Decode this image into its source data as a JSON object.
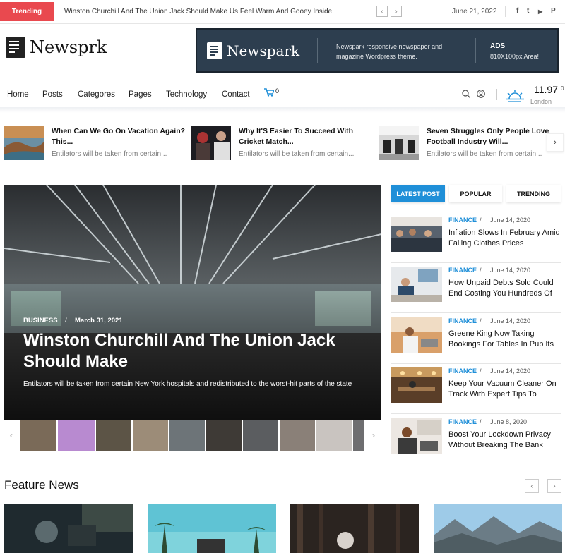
{
  "topbar": {
    "trending_label": "Trending",
    "trending_text": "Winston Churchill And The Union Jack Should Make Us Feel Warm And Gooey Inside",
    "prev_label": "‹",
    "next_label": "›",
    "date": "June 21, 2022",
    "social": [
      "f",
      "t",
      "▶",
      "P"
    ]
  },
  "logo": {
    "text": "Newsprk"
  },
  "ad": {
    "logo_text": "Newspark",
    "description": "Newspark responsive newspaper and magazine Wordpress theme.",
    "label": "ADS",
    "size": "810X100px Area!"
  },
  "nav": {
    "items": [
      "Home",
      "Posts",
      "Categores",
      "Pages",
      "Technology",
      "Contact"
    ],
    "cart_count": "0",
    "weather": {
      "temp": "11.97",
      "deg": "0",
      "city": "London"
    }
  },
  "strip": {
    "items": [
      {
        "title": "When Can We Go On Vacation Again? This...",
        "sub": "Entilators will be taken from certain..."
      },
      {
        "title": "Why It'S Easier To Succeed With Cricket Match...",
        "sub": "Entilators will be taken from certain..."
      },
      {
        "title": "Seven Struggles Only People Love Football Industry Will...",
        "sub": "Entilators will be taken from certain..."
      }
    ],
    "next_label": "›"
  },
  "hero": {
    "category": "BUSINESS",
    "slash": "/",
    "date": "March 31, 2021",
    "title": "Winston Churchill And The Union Jack Should Make",
    "description": "Entilators will be taken from certain New York hospitals and redistributed to the worst-hit parts of the state",
    "prev_label": "‹",
    "next_label": "›"
  },
  "sidebar": {
    "tabs": [
      "LATEST POST",
      "POPULAR",
      "TRENDING"
    ],
    "posts": [
      {
        "category": "FINANCE",
        "date": "June 14, 2020",
        "title": "Inflation Slows In February Amid Falling Clothes Prices"
      },
      {
        "category": "FINANCE",
        "date": "June 14, 2020",
        "title": "How Unpaid Debts Sold Could End Costing You Hundreds Of"
      },
      {
        "category": "FINANCE",
        "date": "June 14, 2020",
        "title": "Greene King Now Taking Bookings For Tables In Pub Its"
      },
      {
        "category": "FINANCE",
        "date": "June 14, 2020",
        "title": "Keep Your Vacuum Cleaner On Track With Expert Tips To"
      },
      {
        "category": "FINANCE",
        "date": "June 8, 2020",
        "title": "Boost Your Lockdown Privacy Without Breaking The Bank"
      }
    ]
  },
  "feature": {
    "title": "Feature News",
    "prev_label": "‹",
    "next_label": "›"
  },
  "colors": {
    "accent": "#1f8fd8",
    "trending": "#e9494f",
    "ad_bg": "#2d3e4f"
  },
  "icons": [
    "facebook-icon",
    "twitter-icon",
    "youtube-icon",
    "pinterest-icon",
    "cart-icon",
    "search-icon",
    "user-icon",
    "weather-sun-icon",
    "chevron-left-icon",
    "chevron-right-icon"
  ]
}
